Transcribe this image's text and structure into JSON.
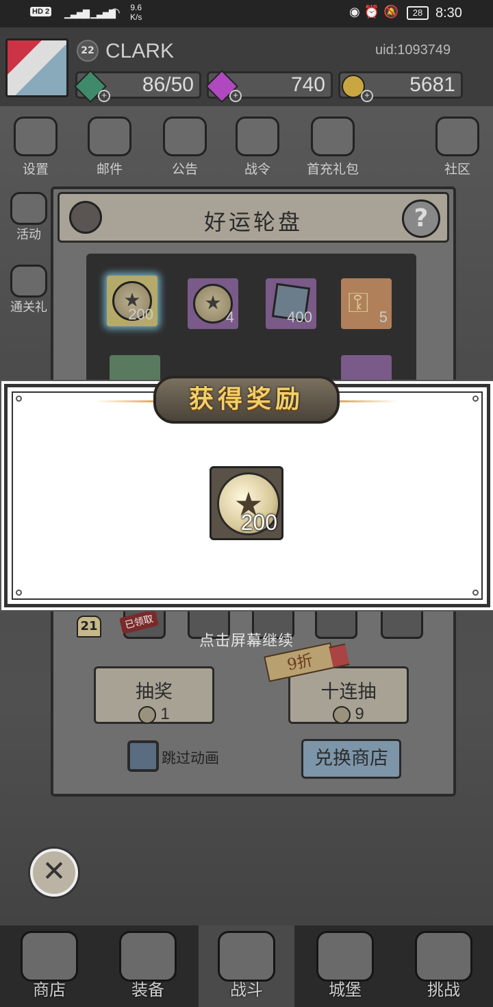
{
  "status_bar": {
    "hd": "HD 2",
    "network_speed": "9.6\nK/s",
    "battery": "28",
    "time": "8:30"
  },
  "player": {
    "level": "22",
    "name": "CLARK",
    "uid": "uid:1093749"
  },
  "resources": {
    "energy": "86/50",
    "gems": "740",
    "gold": "5681"
  },
  "menu": {
    "settings": "设置",
    "mail": "邮件",
    "notice": "公告",
    "battle_pass": "战令",
    "first_charge": "首充礼包",
    "community": "社区",
    "events": "活动",
    "clear_gift": "通关礼"
  },
  "wheel": {
    "title": "好运轮盘",
    "cells": [
      {
        "icon": "gold-coin",
        "qty": "200"
      },
      {
        "icon": "star-coin",
        "qty": "4"
      },
      {
        "icon": "blue-gem",
        "qty": "400"
      },
      {
        "icon": "key",
        "qty": "5"
      }
    ],
    "progress_count": "21",
    "claimed_label": "已领取",
    "draw_label": "抽奖",
    "draw_cost": "1",
    "ten_draw_label": "十连抽",
    "ten_draw_cost": "9",
    "discount": "9折",
    "skip_animation": "跳过动画",
    "exchange_shop": "兑换商店"
  },
  "reward": {
    "title": "获得奖励",
    "item_qty": "200",
    "continue_hint": "点击屏幕继续"
  },
  "nav": {
    "shop": "商店",
    "equipment": "装备",
    "battle": "战斗",
    "castle": "城堡",
    "challenge": "挑战"
  },
  "colors": {
    "banner_text": "#f2cf6a",
    "gem_green": "#3f8a6a",
    "gem_purple": "#b048c0",
    "gold": "#c9a640"
  }
}
